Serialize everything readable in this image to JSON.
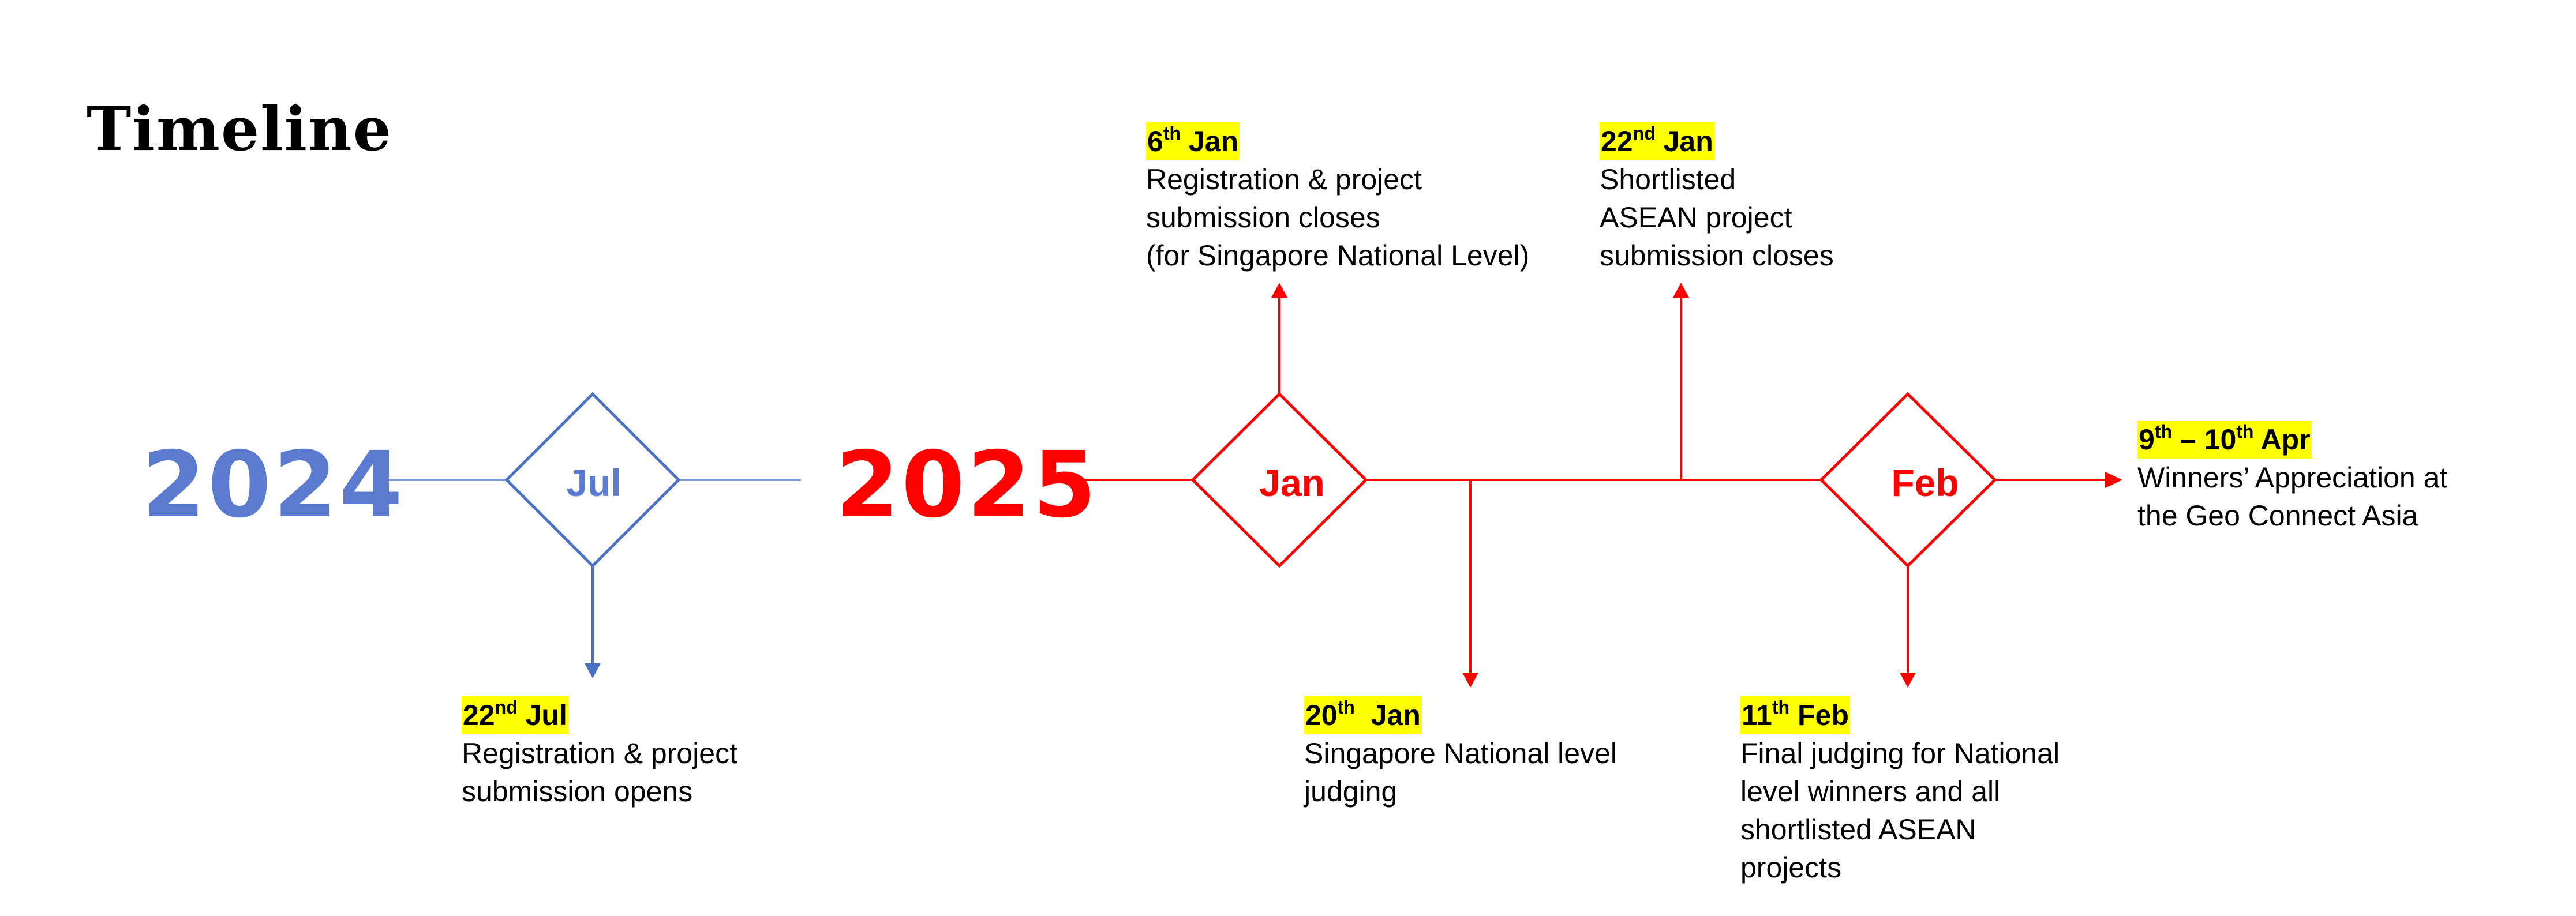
{
  "title": "Timeline",
  "years": {
    "y2024": "2024",
    "y2025": "2025"
  },
  "months": {
    "jul": "Jul",
    "jan": "Jan",
    "feb": "Feb"
  },
  "colors": {
    "blue": "#5a7bd0",
    "red": "#ff0000",
    "highlight": "#ffff00"
  },
  "events": {
    "jul22": {
      "day": "22",
      "suffix": "nd",
      "month": "Jul",
      "lines": [
        "Registration & project",
        "submission opens"
      ]
    },
    "jan6": {
      "day": "6",
      "suffix": "th",
      "month": "Jan",
      "lines": [
        "Registration & project",
        "submission closes",
        "(for Singapore National Level)"
      ]
    },
    "jan20": {
      "day": "20",
      "suffix": "th",
      "month": "Jan",
      "lines": [
        "Singapore National level",
        "judging"
      ]
    },
    "jan22": {
      "day": "22",
      "suffix": "nd",
      "month": "Jan",
      "lines": [
        "Shortlisted",
        "ASEAN project",
        "submission closes"
      ]
    },
    "feb11": {
      "day": "11",
      "suffix": "th",
      "month": "Feb",
      "lines": [
        "Final judging for National",
        "level winners and all",
        "shortlisted ASEAN",
        "projects"
      ]
    },
    "apr": {
      "day1": "9",
      "suffix1": "th",
      "dash": "–",
      "day2": "10",
      "suffix2": "th",
      "month": "Apr",
      "lines": [
        "Winners’ Appreciation at",
        "the Geo Connect Asia"
      ]
    }
  }
}
